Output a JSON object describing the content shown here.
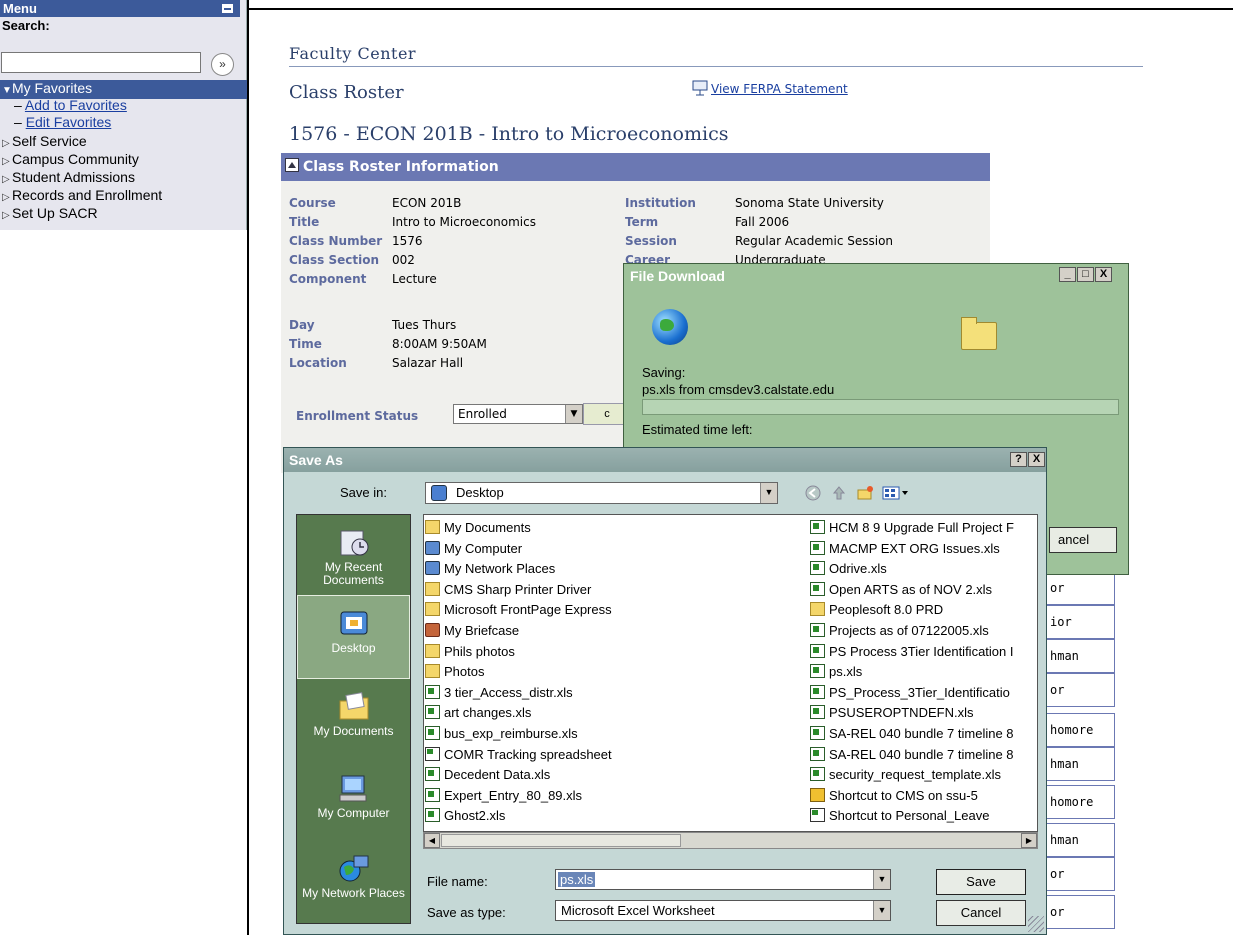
{
  "menu": {
    "title": "Menu",
    "search_label": "Search:",
    "search_value": "",
    "search_go": "»",
    "favorites": "My Favorites",
    "add_favorites": "Add to Favorites",
    "edit_favorites": "Edit Favorites",
    "items": [
      "Self Service",
      "Campus Community",
      "Student Admissions",
      "Records and Enrollment",
      "Set Up SACR"
    ]
  },
  "page": {
    "faculty_center": "Faculty Center",
    "class_roster": "Class Roster",
    "ferpa_link": "View FERPA Statement",
    "course_heading": "1576 - ECON  201B  -  Intro to Microeconomics"
  },
  "roster_info": {
    "header": "Class Roster Information",
    "course_label": "Course",
    "course": "ECON  201B",
    "title_label": "Title",
    "title": "Intro to Microeconomics",
    "class_number_label": "Class Number",
    "class_number": "1576",
    "class_section_label": "Class Section",
    "class_section": "002",
    "component_label": "Component",
    "component": "Lecture",
    "institution_label": "Institution",
    "institution": "Sonoma State University",
    "term_label": "Term",
    "term": "Fall 2006",
    "session_label": "Session",
    "session": "Regular Academic Session",
    "career_label": "Career",
    "career": "Undergraduate",
    "day_label": "Day",
    "day": "Tues  Thurs",
    "time_label": "Time",
    "time": "8:00AM   9:50AM",
    "location_label": "Location",
    "location": "Salazar Hall",
    "enrollment_status_label": "Enrollment Status",
    "enrollment_status": "Enrolled",
    "enroll_button": "c"
  },
  "student_levels": [
    "or",
    "ior",
    "hman",
    "or",
    "homore",
    "hman",
    "homore",
    "hman",
    "or",
    "or"
  ],
  "file_download": {
    "title": "File Download",
    "saving": "Saving:",
    "source": "ps.xls from cmsdev3.calstate.edu",
    "estimated": "Estimated time left:",
    "cancel": "ancel"
  },
  "save_as": {
    "title": "Save As",
    "help_button": "?",
    "close_button": "X",
    "save_in_label": "Save in:",
    "save_in_value": "Desktop",
    "places": [
      "My Recent Documents",
      "Desktop",
      "My Documents",
      "My Computer",
      "My Network Places"
    ],
    "files_left": [
      {
        "name": "My Documents",
        "icon": "doc-folder"
      },
      {
        "name": "My Computer",
        "icon": "computer"
      },
      {
        "name": "My Network Places",
        "icon": "network"
      },
      {
        "name": "CMS Sharp Printer Driver",
        "icon": "folder"
      },
      {
        "name": "Microsoft FrontPage Express",
        "icon": "folder"
      },
      {
        "name": "My Briefcase",
        "icon": "briefcase"
      },
      {
        "name": "Phils photos",
        "icon": "folder"
      },
      {
        "name": "Photos",
        "icon": "folder"
      },
      {
        "name": "3 tier_Access_distr.xls",
        "icon": "excel"
      },
      {
        "name": "art changes.xls",
        "icon": "excel"
      },
      {
        "name": "bus_exp_reimburse.xls",
        "icon": "excel"
      },
      {
        "name": "COMR Tracking spreadsheet",
        "icon": "excel-shortcut"
      },
      {
        "name": "Decedent Data.xls",
        "icon": "excel"
      },
      {
        "name": "Expert_Entry_80_89.xls",
        "icon": "excel"
      },
      {
        "name": "Ghost2.xls",
        "icon": "excel"
      }
    ],
    "files_right": [
      {
        "name": "HCM 8 9 Upgrade Full Project F",
        "icon": "excel"
      },
      {
        "name": "MACMP EXT ORG Issues.xls",
        "icon": "excel"
      },
      {
        "name": "Odrive.xls",
        "icon": "excel"
      },
      {
        "name": "Open ARTS as of NOV 2.xls",
        "icon": "excel"
      },
      {
        "name": "Peoplesoft 8.0 PRD",
        "icon": "folder-shortcut"
      },
      {
        "name": "Projects as of 07122005.xls",
        "icon": "excel"
      },
      {
        "name": "PS Process 3Tier Identification I",
        "icon": "excel"
      },
      {
        "name": "ps.xls",
        "icon": "excel"
      },
      {
        "name": "PS_Process_3Tier_Identificatio",
        "icon": "excel"
      },
      {
        "name": "PSUSEROPTNDEFN.xls",
        "icon": "excel"
      },
      {
        "name": "SA-REL 040  bundle 7 timeline 8",
        "icon": "excel"
      },
      {
        "name": "SA-REL 040 bundle 7 timeline 8",
        "icon": "excel"
      },
      {
        "name": "security_request_template.xls",
        "icon": "excel"
      },
      {
        "name": "Shortcut to CMS on ssu-5",
        "icon": "shortcut"
      },
      {
        "name": "Shortcut to Personal_Leave",
        "icon": "excel-shortcut"
      }
    ],
    "file_name_label": "File name:",
    "file_name_value": "ps.xls",
    "save_type_label": "Save as type:",
    "save_type_value": "Microsoft Excel Worksheet",
    "save_button": "Save",
    "cancel_button": "Cancel"
  }
}
